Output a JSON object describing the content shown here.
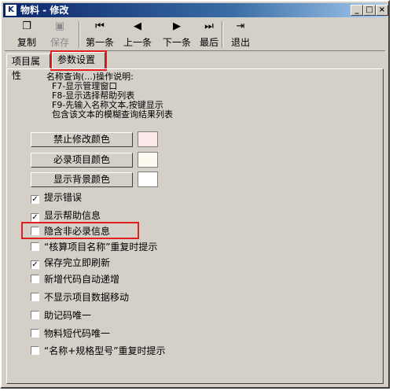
{
  "window": {
    "title": "物料 - 修改",
    "app_icon": "K"
  },
  "toolbar": {
    "copy": "复制",
    "save": "保存",
    "first": "第一条",
    "prev": "上一条",
    "next": "下一条",
    "last": "最后",
    "exit": "退出"
  },
  "tabs": [
    "项目属性",
    "参数设置"
  ],
  "help_text": "名称查询(...)操作说明:\n  F7-显示管理窗口\n  F8-显示选择帮助列表\n  F9-先输入名称文本,按键显示\n  包含该文本的模糊查询结果列表",
  "color_buttons": [
    {
      "label": "禁止修改颜色",
      "color": "#fbe8e8"
    },
    {
      "label": "必录项目颜色",
      "color": "#fffaf0"
    },
    {
      "label": "显示背景颜色",
      "color": "#ffffff"
    }
  ],
  "options": [
    {
      "label": "提示错误",
      "checked": true
    },
    {
      "label": "显示帮助信息",
      "checked": true
    },
    {
      "label": "隐含非必录信息",
      "checked": false
    },
    {
      "label": "“核算项目名称”重复时提示",
      "checked": false
    },
    {
      "label": "保存完立即刷新",
      "checked": true
    },
    {
      "label": "新增代码自动递增",
      "checked": false
    },
    {
      "label": "不显示项目数据移动",
      "checked": false
    },
    {
      "label": "助记码唯一",
      "checked": false
    },
    {
      "label": "物料短代码唯一",
      "checked": false
    },
    {
      "label": "“名称+规格型号”重复时提示",
      "checked": false
    }
  ],
  "colors": {
    "title_start": "#0a246a",
    "highlight": "#e02020",
    "face": "#d4d0c8"
  }
}
